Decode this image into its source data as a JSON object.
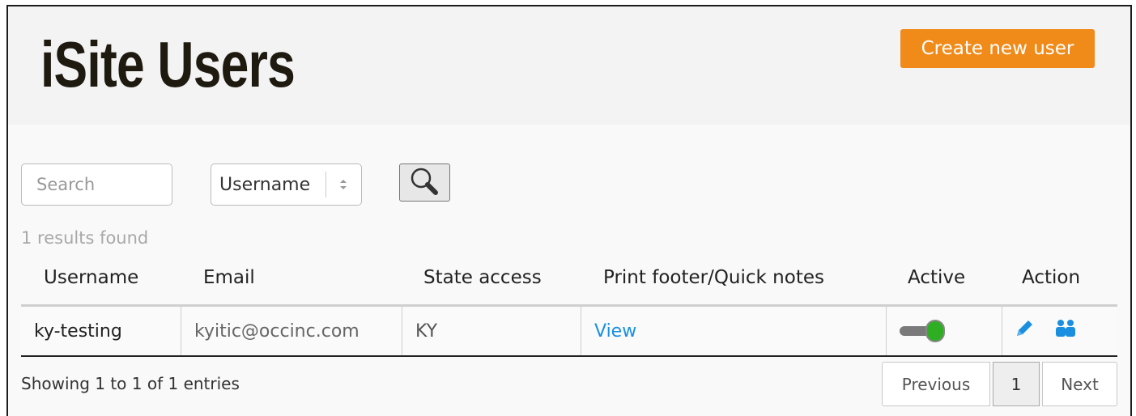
{
  "header": {
    "title": "iSite Users",
    "create_button_label": "Create new user"
  },
  "filters": {
    "search_placeholder": "Search",
    "search_value": "",
    "field_select_value": "Username",
    "search_button_icon": "magnifier-icon"
  },
  "results_text": "1 results found",
  "table": {
    "columns": [
      "Username",
      "Email",
      "State access",
      "Print footer/Quick notes",
      "Active",
      "Action"
    ],
    "rows": [
      {
        "username": "ky-testing",
        "email": "kyitic@occinc.com",
        "state_access": "KY",
        "notes_link": "View",
        "active": true,
        "action_icons": [
          "edit-pencil-icon",
          "users-group-icon"
        ]
      }
    ]
  },
  "footer": {
    "entries_info": "Showing 1 to 1 of 1 entries",
    "pagination": {
      "previous_label": "Previous",
      "current_page": "1",
      "next_label": "Next"
    }
  },
  "colors": {
    "accent_orange": "#f08a19",
    "link_blue": "#1a8fe0",
    "toggle_on_green": "#2fae24"
  }
}
